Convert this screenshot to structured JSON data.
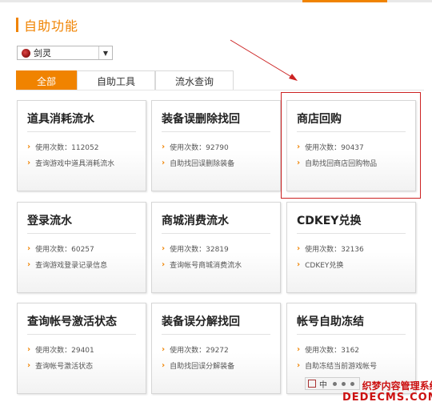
{
  "header": {
    "title": "自助功能"
  },
  "game_select": {
    "value": "剑灵"
  },
  "tabs": [
    {
      "label": "全部",
      "active": true
    },
    {
      "label": "自助工具",
      "active": false
    },
    {
      "label": "流水查询",
      "active": false
    }
  ],
  "cards": [
    {
      "title": "道具消耗流水",
      "usage": "使用次数：112052",
      "desc": "查询游戏中道具消耗流水"
    },
    {
      "title": "装备误删除找回",
      "usage": "使用次数：92790",
      "desc": "自助找回误删除装备"
    },
    {
      "title": "商店回购",
      "usage": "使用次数：90437",
      "desc": "自助找回商店回购物品"
    },
    {
      "title": "登录流水",
      "usage": "使用次数：60257",
      "desc": "查询游戏登录记录信息"
    },
    {
      "title": "商城消费流水",
      "usage": "使用次数：32819",
      "desc": "查询帐号商城消费流水"
    },
    {
      "title": "CDKEY兑换",
      "usage": "使用次数：32136",
      "desc": "CDKEY兑换"
    },
    {
      "title": "查询帐号激活状态",
      "usage": "使用次数：29401",
      "desc": "查询帐号激活状态"
    },
    {
      "title": "装备误分解找回",
      "usage": "使用次数：29272",
      "desc": "自助找回误分解装备"
    },
    {
      "title": "帐号自助冻结",
      "usage": "使用次数：3162",
      "desc": "自助冻结当前游戏帐号"
    }
  ],
  "ime_toolbar": {
    "lang": "中"
  },
  "watermark": {
    "line1": "织梦内容管理系统",
    "line2": "DEDECMS.COM"
  },
  "colors": {
    "accent": "#f08300",
    "annotation": "#cc2222"
  },
  "icons": {
    "chevron": "chevron-right-icon",
    "game": "game-logo-icon"
  }
}
